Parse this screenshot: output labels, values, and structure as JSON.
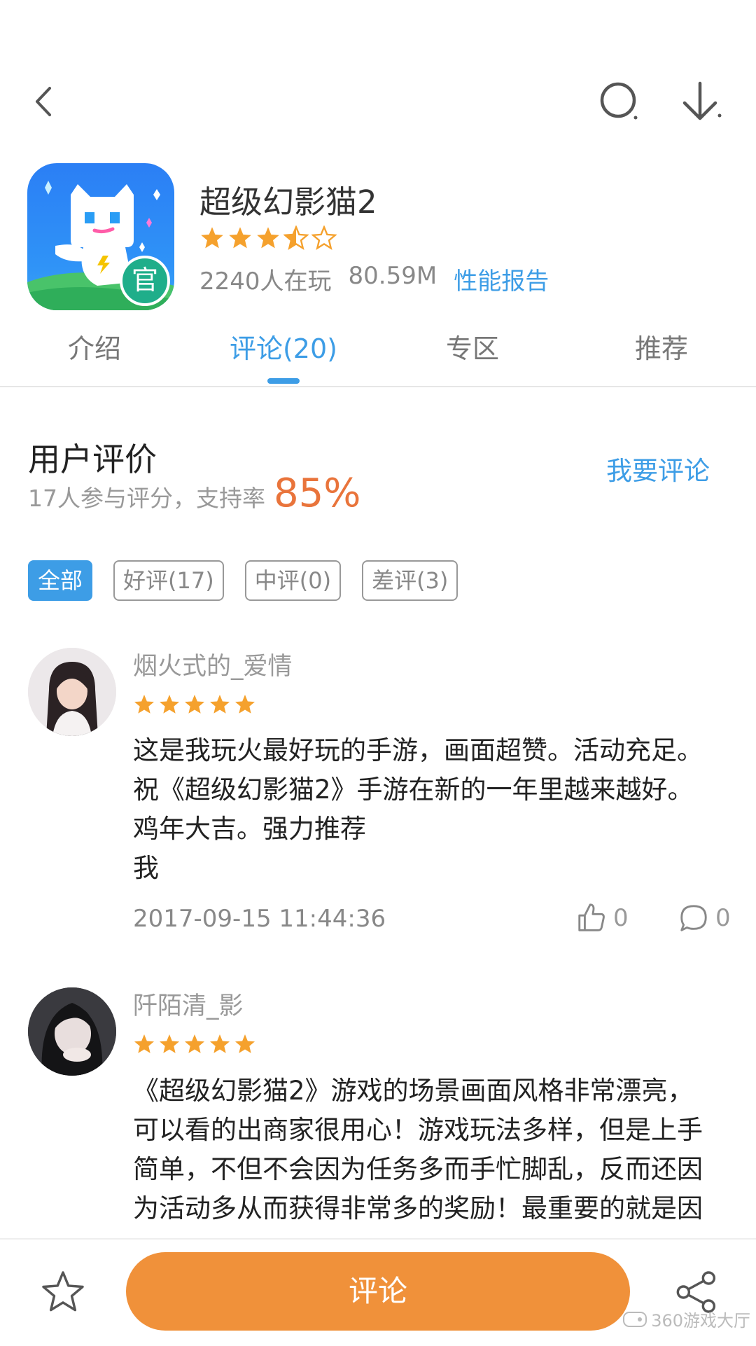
{
  "app": {
    "title": "超级幻影猫2",
    "rating_stars": 3.5,
    "players": "2240人在玩",
    "size": "80.59M",
    "report_link": "性能报告",
    "official_badge": "官"
  },
  "tabs": [
    {
      "label": "介绍"
    },
    {
      "label": "评论(20)"
    },
    {
      "label": "专区"
    },
    {
      "label": "推荐"
    }
  ],
  "summary": {
    "title": "用户评价",
    "subtitle": "17人参与评分，支持率",
    "percent": "85%",
    "write_link": "我要评论"
  },
  "filters": [
    {
      "label": "全部"
    },
    {
      "label": "好评(17)"
    },
    {
      "label": "中评(0)"
    },
    {
      "label": "差评(3)"
    }
  ],
  "reviews": [
    {
      "name": "烟火式的_爱情",
      "stars": 5,
      "text_lines": [
        "这是我玩火最好玩的手游，画面超赞。活动充足。",
        "祝《超级幻影猫2》手游在新的一年里越来越好。",
        "鸡年大吉。强力推荐",
        "我"
      ],
      "date": "2017-09-15 11:44:36",
      "likes": "0",
      "comments": "0"
    },
    {
      "name": "阡陌清_影",
      "stars": 5,
      "text_lines": [
        "《超级幻影猫2》游戏的场景画面风格非常漂亮，",
        "可以看的出商家很用心！游戏玩法多样，但是上手",
        "简单，不但不会因为任务多而手忙脚乱，反而还因",
        "为活动多从而获得非常多的奖励！最重要的就是因"
      ]
    }
  ],
  "bottom": {
    "comment_label": "评论"
  },
  "watermark": "360游戏大厅",
  "colors": {
    "accent_blue": "#3d9de6",
    "star_orange": "#f5a12d",
    "button_orange": "#f0913a",
    "percent_orange": "#e9743b"
  }
}
